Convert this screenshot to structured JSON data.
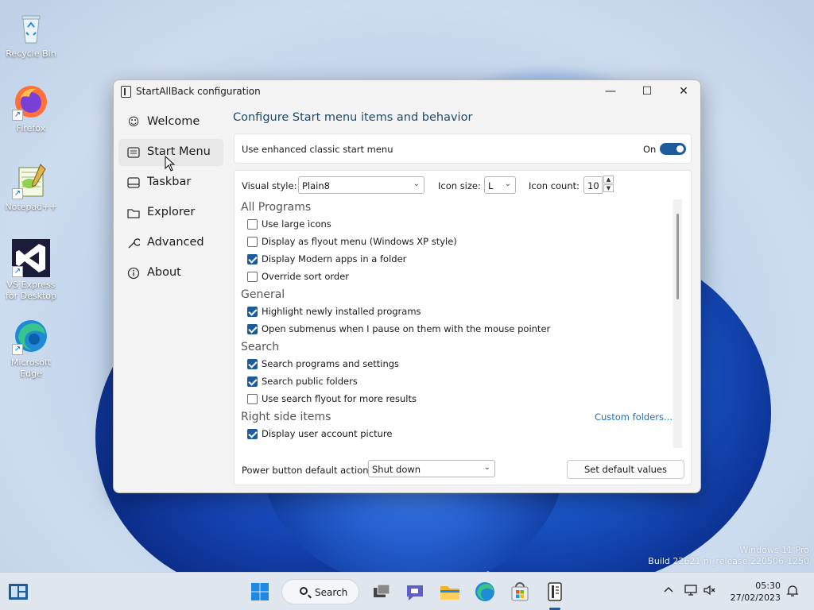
{
  "desktop": {
    "icons": [
      {
        "label": "Recycle Bin"
      },
      {
        "label": "Firefox"
      },
      {
        "label": "Notepad++"
      },
      {
        "label": "VS Express for Desktop"
      },
      {
        "label": "Microsoft Edge"
      }
    ],
    "watermark": {
      "line1": "Windows 11 Pro",
      "line2": "Build 22621.ni_release.220506-1250"
    }
  },
  "window": {
    "title": "StartAllBack configuration",
    "controls": {
      "minimize": "—",
      "maximize": "☐",
      "close": "✕"
    },
    "sidebar": {
      "items": [
        {
          "label": "Welcome",
          "icon": "smile-icon"
        },
        {
          "label": "Start Menu",
          "icon": "start-menu-icon",
          "active": true
        },
        {
          "label": "Taskbar",
          "icon": "taskbar-icon"
        },
        {
          "label": "Explorer",
          "icon": "folder-icon"
        },
        {
          "label": "Advanced",
          "icon": "wrench-icon"
        },
        {
          "label": "About",
          "icon": "info-icon"
        }
      ]
    },
    "main": {
      "title": "Configure Start menu items and behavior",
      "enhanced": {
        "label": "Use enhanced classic start menu",
        "state_label": "On",
        "enabled": true
      },
      "visual_style": {
        "label": "Visual style:",
        "value": "Plain8"
      },
      "icon_size": {
        "label": "Icon size:",
        "value": "L"
      },
      "icon_count": {
        "label": "Icon count:",
        "value": "10"
      },
      "sections": {
        "all_programs": {
          "title": "All Programs",
          "options": [
            {
              "label": "Use large icons",
              "checked": false
            },
            {
              "label": "Display as flyout menu (Windows XP style)",
              "checked": false
            },
            {
              "label": "Display Modern apps in a folder",
              "checked": true
            },
            {
              "label": "Override sort order",
              "checked": false
            }
          ]
        },
        "general": {
          "title": "General",
          "options": [
            {
              "label": "Highlight newly installed programs",
              "checked": true
            },
            {
              "label": "Open submenus when I pause on them with the mouse pointer",
              "checked": true
            }
          ]
        },
        "search": {
          "title": "Search",
          "options": [
            {
              "label": "Search programs and settings",
              "checked": true
            },
            {
              "label": "Search public folders",
              "checked": true
            },
            {
              "label": "Use search flyout for more results",
              "checked": false
            }
          ]
        },
        "right_side": {
          "title": "Right side items",
          "link": "Custom folders...",
          "options": [
            {
              "label": "Display user account picture",
              "checked": true
            }
          ]
        }
      },
      "power": {
        "label": "Power button default action:",
        "value": "Shut down"
      },
      "default_button": "Set default values"
    }
  },
  "taskbar": {
    "search_label": "Search",
    "clock": {
      "time": "05:30",
      "date": "27/02/2023"
    }
  },
  "colors": {
    "accent": "#1e5b9a",
    "link": "#1f6fbf",
    "heading": "#1c4b6c"
  }
}
